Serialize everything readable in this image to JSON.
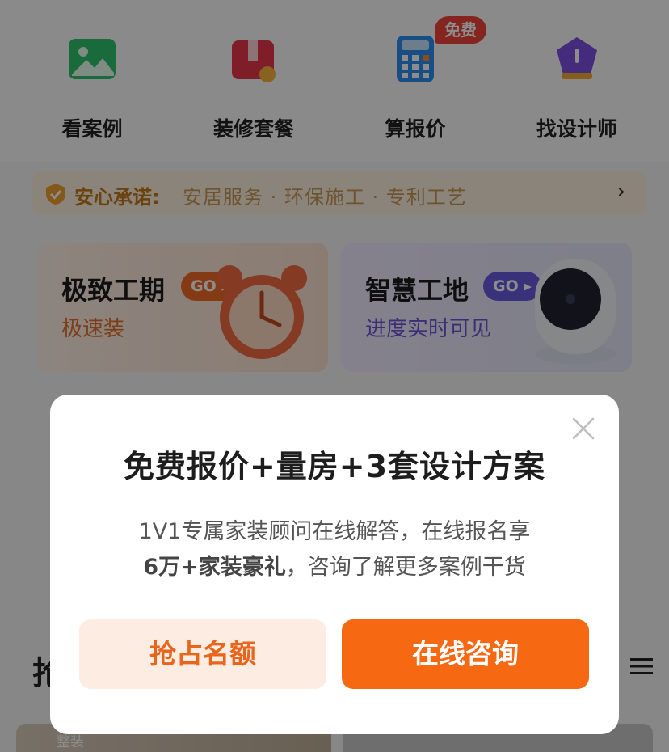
{
  "quick_menu": {
    "items": [
      {
        "label": "看案例",
        "icon": "gallery-icon"
      },
      {
        "label": "装修套餐",
        "icon": "gift-box-icon"
      },
      {
        "label": "算报价",
        "icon": "calculator-icon"
      },
      {
        "label": "找设计师",
        "icon": "designer-badge-icon"
      }
    ],
    "free_badge": "免费"
  },
  "promise_bar": {
    "title": "安心承诺:",
    "items": "安居服务 · 环保施工 · 专利工艺",
    "arrow": "›"
  },
  "promo_cards": [
    {
      "title": "极致工期",
      "go": "GO",
      "subtitle": "极速装",
      "art": "alarm-clock-illustration"
    },
    {
      "title": "智慧工地",
      "go": "GO",
      "subtitle": "进度实时可见",
      "art": "smart-camera-illustration"
    }
  ],
  "section": {
    "title_partial": "抢"
  },
  "thumbs": {
    "left_tag": "整装"
  },
  "modal": {
    "title": "免费报价+量房+3套设计方案",
    "desc_line1": "1V1专属家装顾问在线解答，在线报名享",
    "desc_line2_highlight": "6万+家装豪礼",
    "desc_line2_rest": "，咨询了解更多案例干货",
    "secondary_button": "抢占名额",
    "primary_button": "在线咨询",
    "close_icon": "close-icon"
  },
  "colors": {
    "accent_orange": "#f66812",
    "secondary_bg": "#fdece2",
    "secondary_text": "#e8661c",
    "badge_red": "#f0443a",
    "overlay": "rgba(0,0,0,0.45)"
  }
}
